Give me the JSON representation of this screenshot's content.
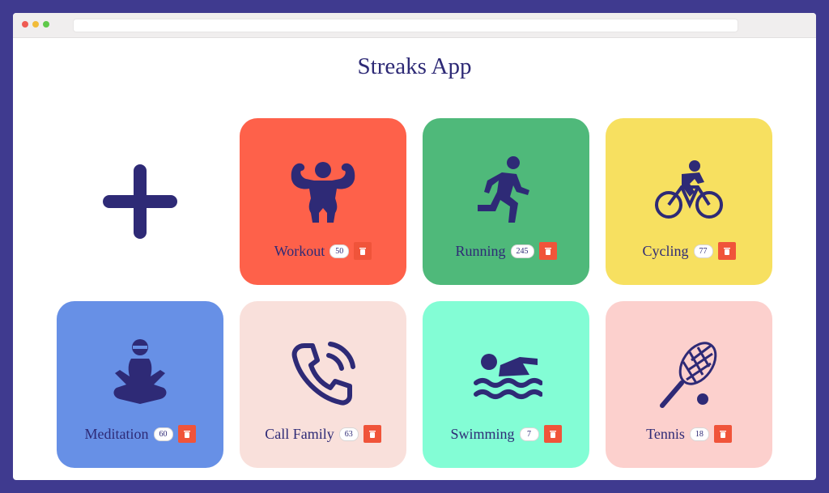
{
  "browser": {
    "dots": [
      "#ef5b52",
      "#f1bc3a",
      "#5fc94a"
    ]
  },
  "app": {
    "title": "Streaks App",
    "add_icon": "plus-icon"
  },
  "theme": {
    "ink": "#2e2a76",
    "delete_color": "#f0543a"
  },
  "streaks": [
    {
      "name": "Workout",
      "count": "50",
      "icon": "bodybuilder-icon",
      "color": "#fe614a"
    },
    {
      "name": "Running",
      "count": "245",
      "icon": "runner-icon",
      "color": "#4fb97a"
    },
    {
      "name": "Cycling",
      "count": "77",
      "icon": "cyclist-icon",
      "color": "#f7e060"
    },
    {
      "name": "Meditation",
      "count": "60",
      "icon": "meditation-icon",
      "color": "#6790e6"
    },
    {
      "name": "Call Family",
      "count": "63",
      "icon": "phone-icon",
      "color": "#f9e0db"
    },
    {
      "name": "Swimming",
      "count": "7",
      "icon": "swimmer-icon",
      "color": "#83fdd5"
    },
    {
      "name": "Tennis",
      "count": "18",
      "icon": "tennis-racket-icon",
      "color": "#fcd0cd"
    }
  ]
}
